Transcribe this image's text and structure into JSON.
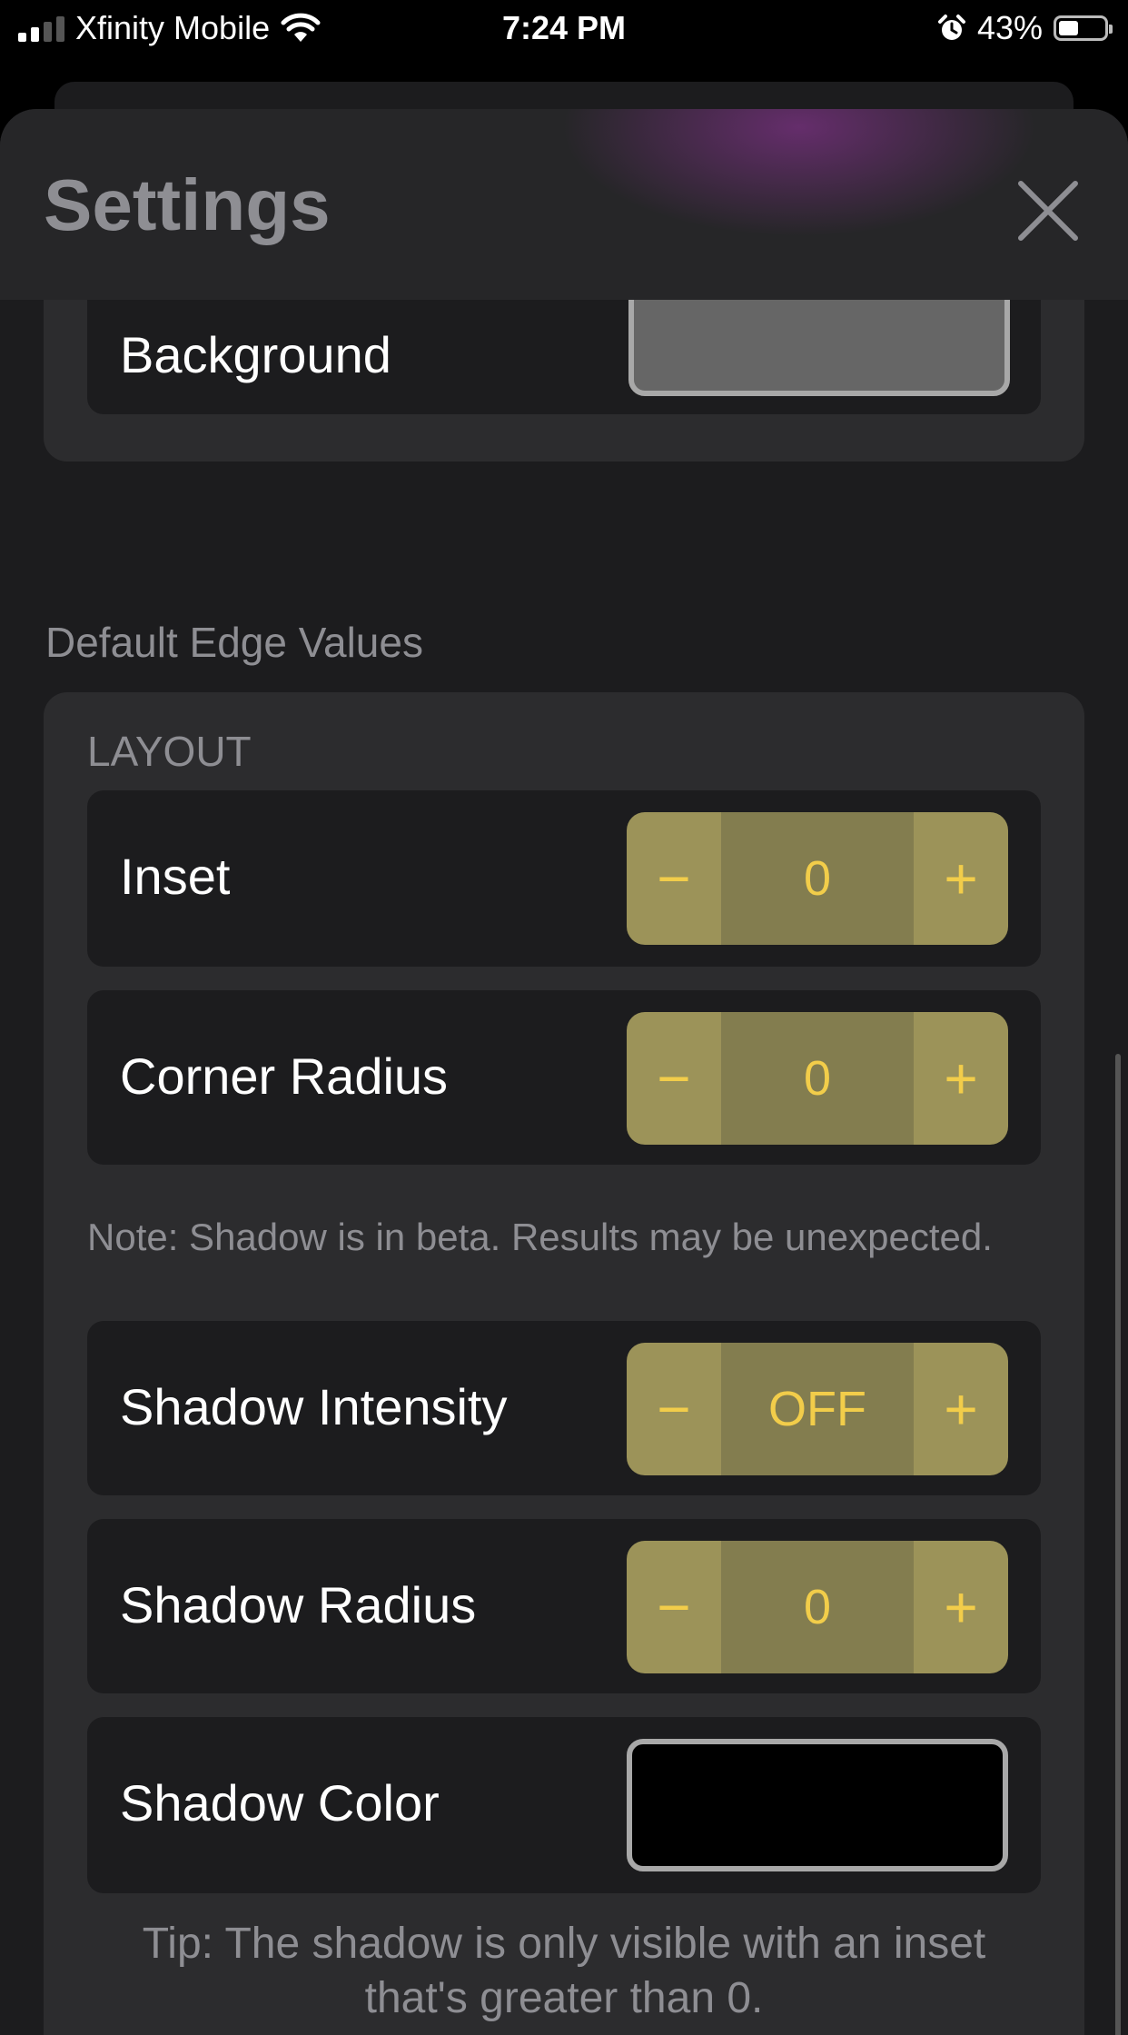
{
  "status_bar": {
    "carrier": "Xfinity Mobile",
    "time": "7:24 PM",
    "battery": "43%",
    "battery_level": 0.43
  },
  "header": {
    "title": "Settings",
    "close_icon": "close-icon"
  },
  "appearance": {
    "background_label": "Background",
    "background_color": "#666666"
  },
  "edge_values": {
    "section_title": "Default Edge Values",
    "layout_header": "LAYOUT",
    "rows": [
      {
        "label": "Inset",
        "value": "0"
      },
      {
        "label": "Corner Radius",
        "value": "0"
      }
    ],
    "note": "Note: Shadow is in beta. Results may be unexpected.",
    "shadow_rows": [
      {
        "label": "Shadow Intensity",
        "value": "OFF"
      },
      {
        "label": "Shadow Radius",
        "value": "0"
      }
    ],
    "shadow_color_label": "Shadow Color",
    "shadow_color": "#000000",
    "tip": "Tip: The shadow is only visible with an inset that's greater than 0."
  },
  "stepper": {
    "minus": "−",
    "plus": "+"
  },
  "colors": {
    "accent": "#f2cd4a",
    "stepper_button": "#9c9359",
    "stepper_value": "#837d4f"
  }
}
